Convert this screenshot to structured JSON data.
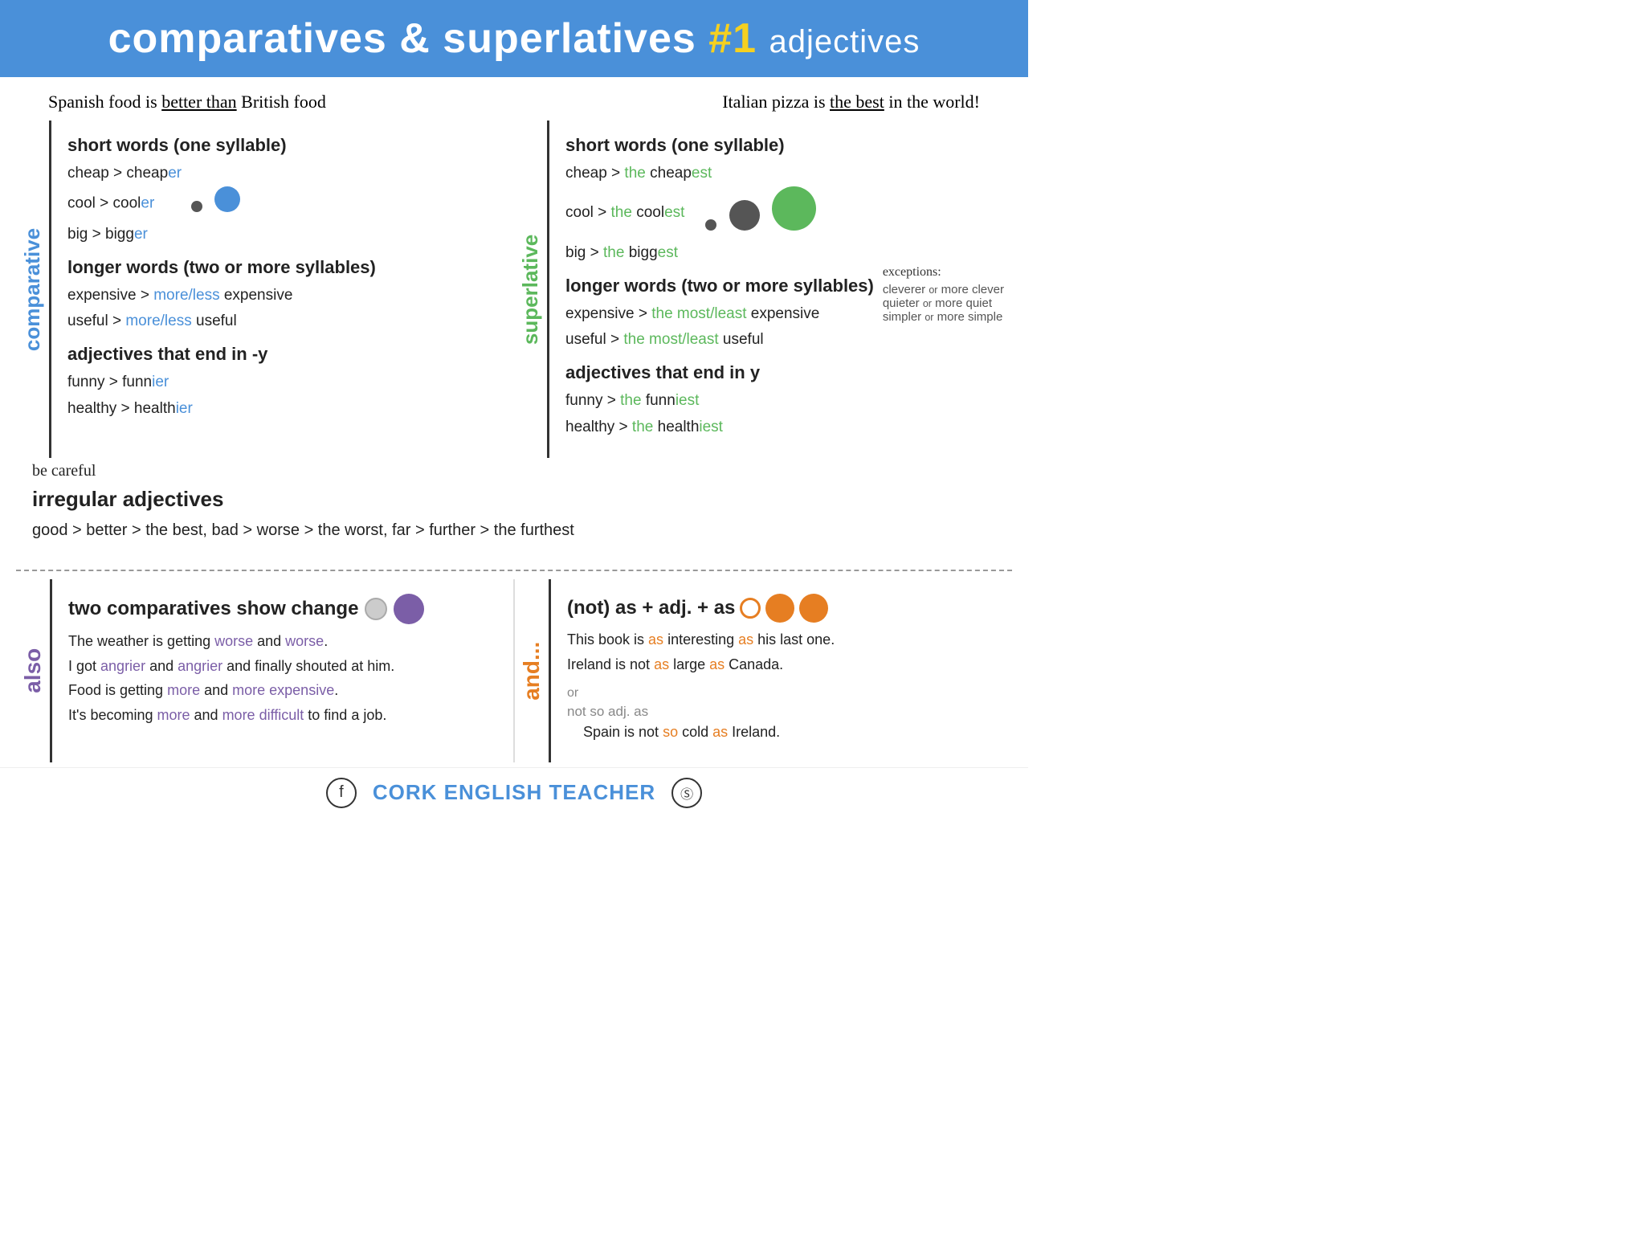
{
  "header": {
    "title_main": "comparatives & superlatives",
    "title_number": "#1",
    "title_suffix": "adjectives"
  },
  "examples": {
    "left": "Spanish food is better than British food",
    "left_underline": "better than",
    "right": "Italian pizza is the best in the world!",
    "right_underline": "the best"
  },
  "comparative": {
    "label": "comparative",
    "short_title": "short words (one syllable)",
    "short_items": [
      {
        "base": "cheap > cheap",
        "ending": "er"
      },
      {
        "base": "cool > cool",
        "ending": "er"
      },
      {
        "base": "big > bigg",
        "ending": "er"
      }
    ],
    "longer_title": "longer words (two or more syllables)",
    "longer_items": [
      {
        "base": "expensive > ",
        "colored": "more/less",
        "rest": " expensive"
      },
      {
        "base": "useful > ",
        "colored": "more/less",
        "rest": " useful"
      }
    ],
    "endy_title": "adjectives that end in -y",
    "endy_items": [
      {
        "base": "funny > funn",
        "ending": "ier"
      },
      {
        "base": "healthy > health",
        "ending": "ier"
      }
    ]
  },
  "superlative": {
    "label": "superlative",
    "short_title": "short words (one syllable)",
    "short_items": [
      {
        "base": "cheap > ",
        "the": "the",
        "word": " cheap",
        "ending": "est"
      },
      {
        "base": "cool > ",
        "the": "the",
        "word": " cool",
        "ending": "est"
      },
      {
        "base": "big > ",
        "the": "the",
        "word": " bigg",
        "ending": "est"
      }
    ],
    "longer_title": "longer words (two or more syllables)",
    "longer_items": [
      {
        "base": "expensive > ",
        "colored": "the most/least",
        "rest": " expensive"
      },
      {
        "base": "useful > ",
        "colored": "the most/least",
        "rest": " useful"
      }
    ],
    "endy_title": "adjectives that end in y",
    "endy_items": [
      {
        "base": "funny > ",
        "the": "the",
        "word": " funn",
        "ending": "iest"
      },
      {
        "base": "healthy > ",
        "the": "the",
        "word": " health",
        "ending": "iest"
      }
    ],
    "exceptions_title": "exceptions:",
    "exceptions": [
      "cleverer or more clever",
      "quieter or more quiet",
      "simpler or more simple"
    ]
  },
  "irregular": {
    "be_careful": "be careful",
    "title": "irregular adjectives",
    "content": "good > better > the best, bad > worse > the worst, far > further > the furthest"
  },
  "also": {
    "label": "also",
    "title": "two comparatives show change",
    "sentences": [
      {
        "text": "The weather is getting ",
        "w1": "worse",
        "mid": " and ",
        "w2": "worse",
        "end": "."
      },
      {
        "text": "I got ",
        "w1": "angrier",
        "mid": " and ",
        "w2": "angrier",
        "end": " and finally shouted at him."
      },
      {
        "text": "Food is getting ",
        "w1": "more",
        "mid": " and ",
        "w2": "more expensive",
        "end": "."
      },
      {
        "text": "It's becoming ",
        "w1": "more",
        "mid": " and ",
        "w2": "more difficult",
        "end": " to find a job."
      }
    ]
  },
  "and": {
    "label": "and...",
    "title": "(not) as + adj. + as",
    "sentences": [
      "This book is as interesting as his last one.",
      "Ireland is not as large as Canada."
    ],
    "or_text": "or",
    "not_so_text": "not so adj. as",
    "spain_sentence": "Spain is not so cold as Ireland."
  },
  "footer": {
    "site_name": "CORK ENGLISH TEACHER",
    "fb_icon": "f",
    "ig_icon": "📷"
  }
}
